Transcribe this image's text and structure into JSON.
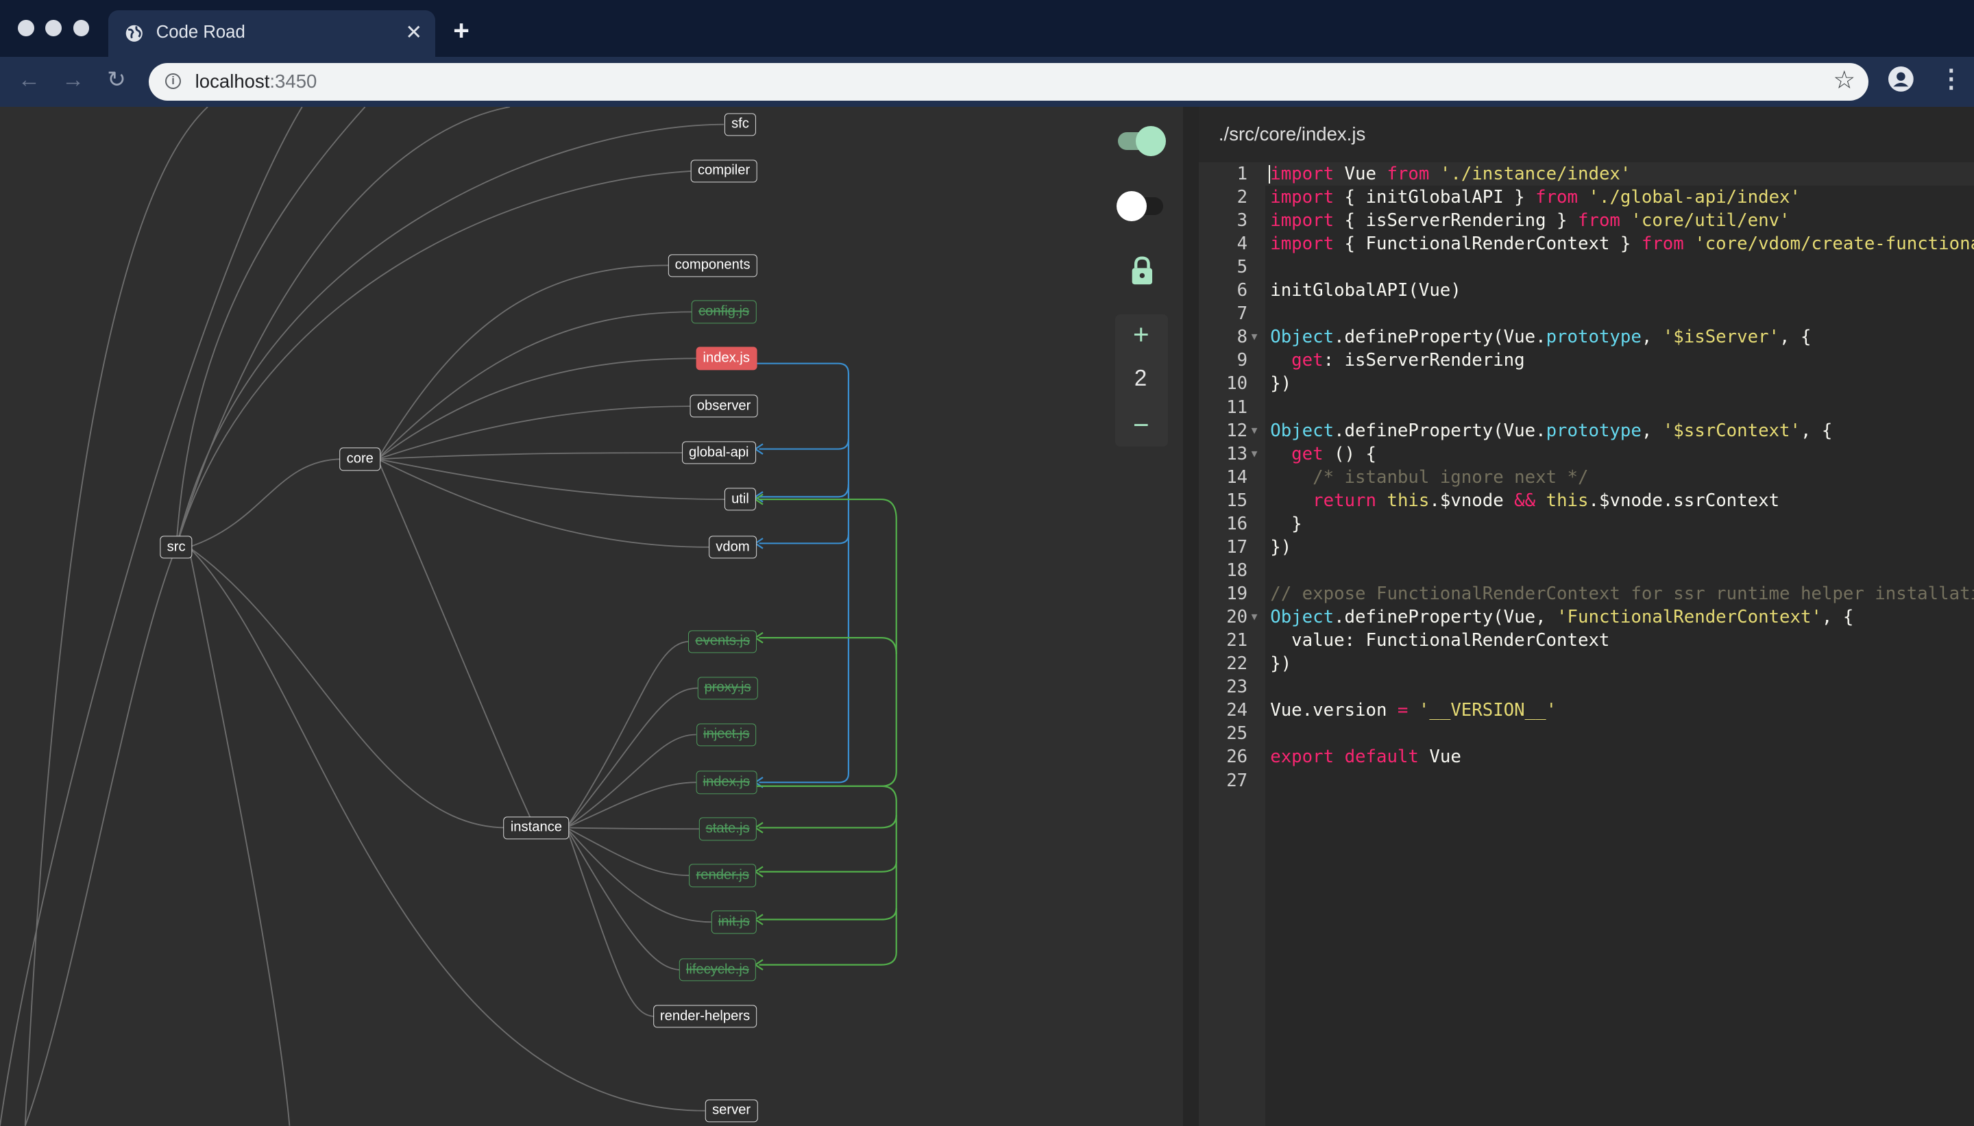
{
  "browser": {
    "tab_title": "Code Road",
    "url_host": "localhost",
    "url_port": ":3450"
  },
  "graph": {
    "nodes": {
      "sfc": "sfc",
      "compiler": "compiler",
      "components": "components",
      "config": "config.js",
      "core_index": "index.js",
      "observer": "observer",
      "global_api": "global-api",
      "util": "util",
      "vdom": "vdom",
      "core": "core",
      "src": "src",
      "events": "events.js",
      "proxy": "proxy.js",
      "inject": "inject.js",
      "instance_index": "index.js",
      "state": "state.js",
      "render": "render.js",
      "init": "init.js",
      "lifecycle": "lifecycle.js",
      "instance": "instance",
      "render_helpers": "render-helpers",
      "server": "server"
    },
    "controls": {
      "zoom_level": "2",
      "toggle1_on": true,
      "toggle2_on": false
    },
    "colors": {
      "active": "#e15a5c",
      "dependency_blue": "#3a8fd0",
      "dependency_green": "#53b04b",
      "accent": "#a9e5c3"
    }
  },
  "editor": {
    "file_path": "./src/core/index.js"
  }
}
